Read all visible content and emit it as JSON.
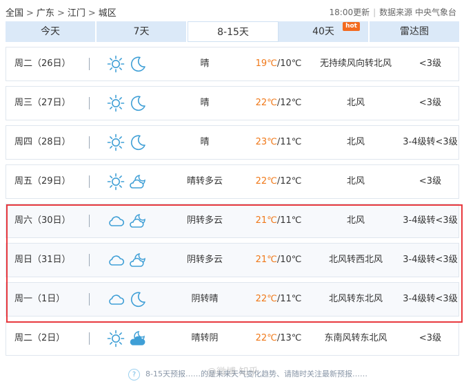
{
  "breadcrumb": {
    "items": [
      "全国",
      "广东",
      "江门",
      "城区"
    ],
    "separator": ">"
  },
  "meta": {
    "updated": "18:00更新",
    "source": "数据来源 中央气象台"
  },
  "tabs": [
    {
      "label": "今天",
      "active": false
    },
    {
      "label": "7天",
      "active": false
    },
    {
      "label": "8-15天",
      "active": true
    },
    {
      "label": "40天",
      "active": false,
      "badge": "hot"
    },
    {
      "label": "雷达图",
      "active": false
    }
  ],
  "colors": {
    "high_temp": "#f07818",
    "tab_bg": "#dbe9f8",
    "highlight_border": "#e8383d",
    "icon_stroke": "#3f9fd6",
    "sun": "#3f9fd6"
  },
  "forecast": [
    {
      "date": "周二（26日）",
      "icons": [
        "sun-icon",
        "moon-icon"
      ],
      "condition": "晴",
      "high": "19℃",
      "low": "/10℃",
      "wind": "无持续风向转北风",
      "level": "<3级"
    },
    {
      "date": "周三（27日）",
      "icons": [
        "sun-icon",
        "moon-icon"
      ],
      "condition": "晴",
      "high": "22℃",
      "low": "/12℃",
      "wind": "北风",
      "level": "<3级"
    },
    {
      "date": "周四（28日）",
      "icons": [
        "sun-icon",
        "moon-icon"
      ],
      "condition": "晴",
      "high": "23℃",
      "low": "/11℃",
      "wind": "北风",
      "level": "3-4级转<3级"
    },
    {
      "date": "周五（29日）",
      "icons": [
        "sun-icon",
        "cloudy-night-icon"
      ],
      "condition": "晴转多云",
      "high": "22℃",
      "low": "/12℃",
      "wind": "北风",
      "level": "<3级"
    },
    {
      "date": "周六（30日）",
      "icons": [
        "cloud-icon",
        "cloudy-night-icon"
      ],
      "condition": "阴转多云",
      "high": "21℃",
      "low": "/11℃",
      "wind": "北风",
      "level": "3-4级转<3级"
    },
    {
      "date": "周日（31日）",
      "icons": [
        "cloud-icon",
        "cloudy-night-icon"
      ],
      "condition": "阴转多云",
      "high": "21℃",
      "low": "/10℃",
      "wind": "北风转西北风",
      "level": "3-4级转<3级"
    },
    {
      "date": "周一（1日）",
      "icons": [
        "cloud-icon",
        "moon-icon"
      ],
      "condition": "阴转晴",
      "high": "22℃",
      "low": "/11℃",
      "wind": "北风转东北风",
      "level": "3-4级转<3级"
    },
    {
      "date": "周二（2日）",
      "icons": [
        "sun-icon",
        "overcast-night-icon"
      ],
      "condition": "晴转阴",
      "high": "22℃",
      "low": "/13℃",
      "wind": "东南风转东北风",
      "level": "<3级"
    }
  ],
  "footer": {
    "text": "8-15天预报……的是未来天气变化趋势、请随时关注最新预报……",
    "icon": "question-icon"
  },
  "watermark": "@微博 知乎"
}
